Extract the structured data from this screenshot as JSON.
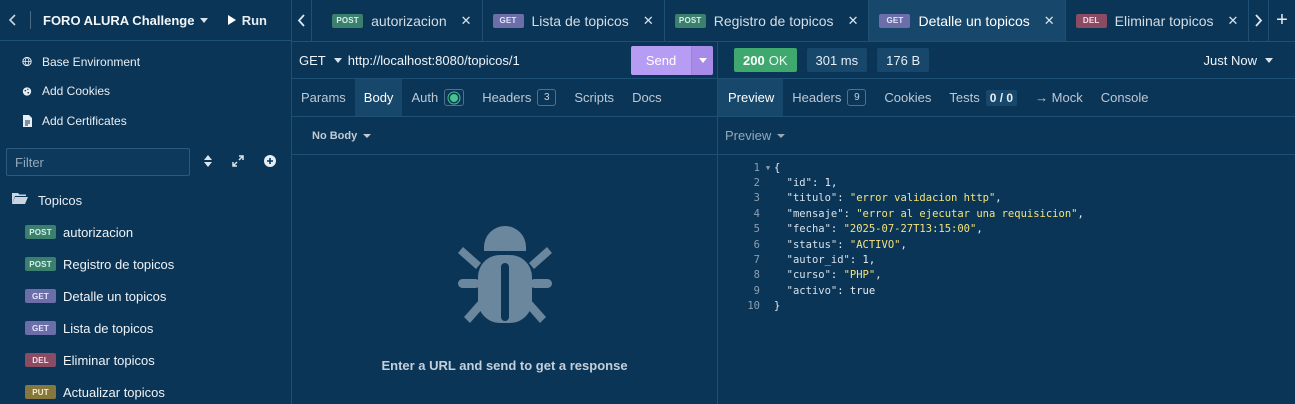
{
  "sidebar": {
    "project_title": "FORO ALURA Challenge",
    "run_label": "Run",
    "env_items": [
      {
        "label": "Base Environment",
        "icon": "globe-icon"
      },
      {
        "label": "Add Cookies",
        "icon": "cookie-icon"
      },
      {
        "label": "Add Certificates",
        "icon": "certificate-icon"
      }
    ],
    "filter_placeholder": "Filter",
    "folder_name": "Topicos",
    "requests": [
      {
        "method": "POST",
        "label": "autorizacion"
      },
      {
        "method": "POST",
        "label": "Registro de topicos"
      },
      {
        "method": "GET",
        "label": "Detalle un topicos"
      },
      {
        "method": "GET",
        "label": "Lista de topicos"
      },
      {
        "method": "DEL",
        "label": "Eliminar topicos"
      },
      {
        "method": "PUT",
        "label": "Actualizar topicos"
      }
    ]
  },
  "tabs": [
    {
      "method": "POST",
      "label": "autorizacion",
      "active": false
    },
    {
      "method": "GET",
      "label": "Lista de topicos",
      "active": false
    },
    {
      "method": "POST",
      "label": "Registro de topicos",
      "active": false
    },
    {
      "method": "GET",
      "label": "Detalle un topicos",
      "active": true
    },
    {
      "method": "DEL",
      "label": "Eliminar topicos",
      "active": false
    }
  ],
  "request": {
    "method": "GET",
    "url": "http://localhost:8080/topicos/1",
    "send_label": "Send",
    "tabs": {
      "params": "Params",
      "body": "Body",
      "auth": "Auth",
      "headers": "Headers",
      "headers_count": "3",
      "scripts": "Scripts",
      "docs": "Docs"
    },
    "body_type": "No Body",
    "empty_message": "Enter a URL and send to get a response"
  },
  "response": {
    "status_code": "200",
    "status_text": "OK",
    "time": "301 ms",
    "size": "176 B",
    "when": "Just Now",
    "tabs": {
      "preview": "Preview",
      "headers": "Headers",
      "headers_count": "9",
      "cookies": "Cookies",
      "tests": "Tests",
      "tests_count": "0 / 0",
      "mock": "→ Mock",
      "console": "Console"
    },
    "preview_mode": "Preview",
    "json_lines": [
      {
        "n": "1",
        "key": "",
        "val": "",
        "raw": "{"
      },
      {
        "n": "2",
        "key": "\"id\"",
        "val": "1",
        "type": "n",
        "comma": ","
      },
      {
        "n": "3",
        "key": "\"titulo\"",
        "val": "\"error validacion http\"",
        "type": "s",
        "comma": ","
      },
      {
        "n": "4",
        "key": "\"mensaje\"",
        "val": "\"error al ejecutar una requisicion\"",
        "type": "s",
        "comma": ","
      },
      {
        "n": "5",
        "key": "\"fecha\"",
        "val": "\"2025-07-27T13:15:00\"",
        "type": "s",
        "comma": ","
      },
      {
        "n": "6",
        "key": "\"status\"",
        "val": "\"ACTIVO\"",
        "type": "s",
        "comma": ","
      },
      {
        "n": "7",
        "key": "\"autor_id\"",
        "val": "1",
        "type": "n",
        "comma": ","
      },
      {
        "n": "8",
        "key": "\"curso\"",
        "val": "\"PHP\"",
        "type": "s",
        "comma": ","
      },
      {
        "n": "9",
        "key": "\"activo\"",
        "val": "true",
        "type": "n",
        "comma": ""
      },
      {
        "n": "10",
        "key": "",
        "val": "",
        "raw": "}"
      }
    ]
  },
  "colors": {
    "background": "#0b3556",
    "send_button": "#b69cf2",
    "status_ok": "#3ea86f",
    "post_badge": "#3b7f6d",
    "get_badge": "#6b6ea8",
    "del_badge": "#8a4b63",
    "put_badge": "#86783c"
  }
}
